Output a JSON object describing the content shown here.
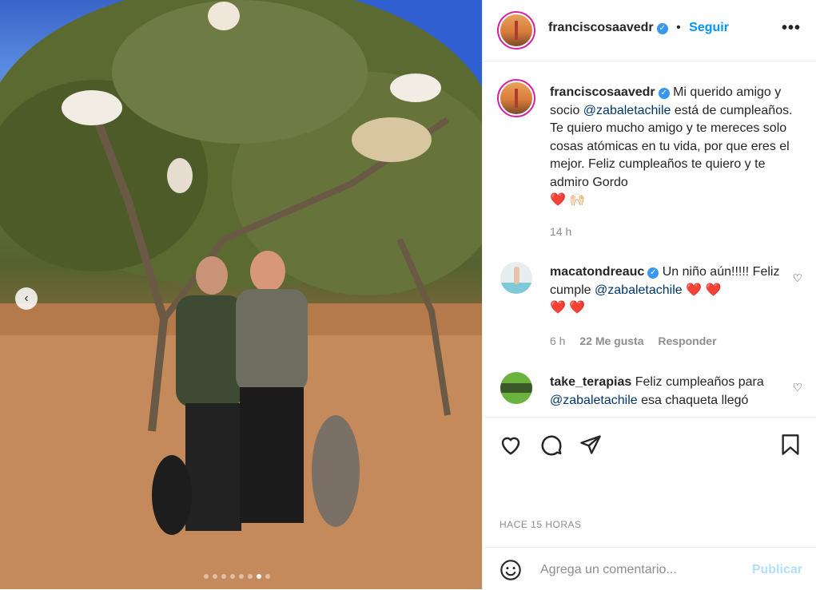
{
  "post": {
    "username": "franciscosaavedr",
    "follow_label": "Seguir",
    "more_icon": "more-options-icon",
    "photo_alt": "Dos hombres posando junto a cabras en un árbol de argán",
    "carousel": {
      "total": 8,
      "active": 7
    }
  },
  "caption": {
    "username": "franciscosaavedr",
    "text_before": " Mi querido amigo y socio ",
    "mention": "@zabaletachile",
    "text_after": " está de cumpleaños. Te quiero mucho amigo y te mereces solo cosas atómicas en tu vida, por que eres el mejor. Feliz cumpleaños te quiero y te admiro Gordo",
    "emojis": "❤️ 🙌🏻",
    "time": "14 h"
  },
  "comments": [
    {
      "username": "macatondreauc",
      "text_before": " Un niño aún!!!!! Feliz cumple ",
      "mention": "@zabaletachile",
      "emojis_inline": "❤️ ❤️",
      "emojis_line2": "❤️ ❤️",
      "time": "6 h",
      "likes": "22 Me gusta",
      "reply": "Responder"
    },
    {
      "username": "take_terapias",
      "text_before": " Feliz cumpleaños para ",
      "mention": "@zabaletachile",
      "text_after": " esa chaqueta llegó"
    }
  ],
  "timestamp": "HACE 15 HORAS",
  "composer": {
    "placeholder": "Agrega un comentario...",
    "publish_label": "Publicar"
  },
  "colors": {
    "link": "#0095f6",
    "mention": "#00376b",
    "muted": "#8e8e8e",
    "heart": "#ed1c24"
  }
}
